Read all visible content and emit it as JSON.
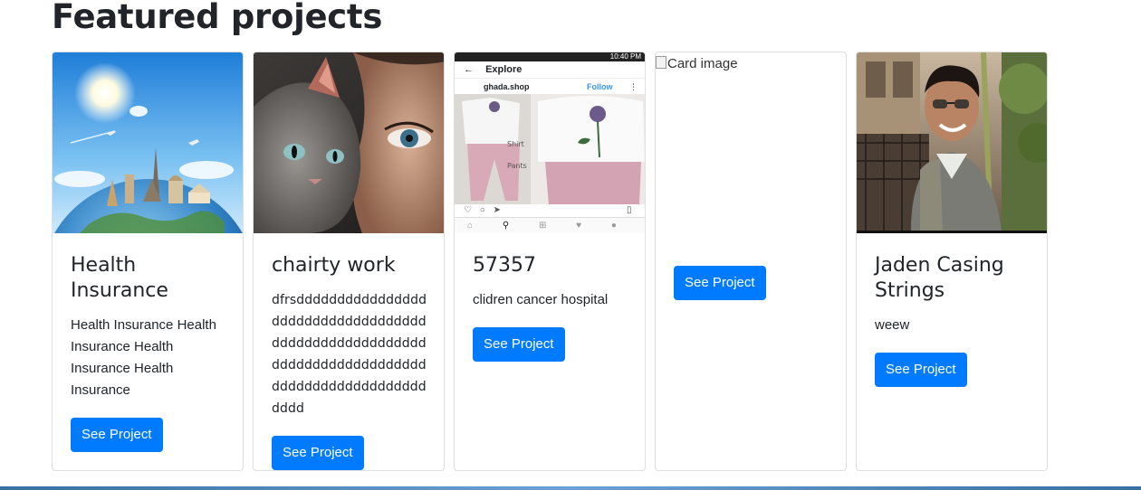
{
  "header": {
    "title": "Featured projects"
  },
  "cards": [
    {
      "image_alt": "Travel landmarks on a globe",
      "title": "Health Insurance",
      "text": "Health Insurance Health Insurance Health Insurance Health Insurance",
      "button": "See Project"
    },
    {
      "image_alt": "Cat and woman portrait",
      "title": "chairty work",
      "text": "dfrsdddddddddddddddddddddddddddddddddddddddddddddddddddddddddddddddddddddddddddddddddddddddddddddddd",
      "button": "See Project"
    },
    {
      "image_alt": "Instagram explore screenshot",
      "title": "57357",
      "text": "clidren cancer hospital",
      "button": "See Project",
      "phone": {
        "status_time": "10:40 PM",
        "screen_title": "Explore",
        "account": "ghada.shop",
        "follow": "Follow",
        "caption_shirt": "Shirt",
        "caption_pants": "Pants"
      }
    },
    {
      "image_alt": "Card image",
      "title": "",
      "text": "",
      "button": "See Project"
    },
    {
      "image_alt": "Man holding sugarcane",
      "title": "Jaden Casing Strings",
      "text": "weew",
      "button": "See Project"
    }
  ]
}
